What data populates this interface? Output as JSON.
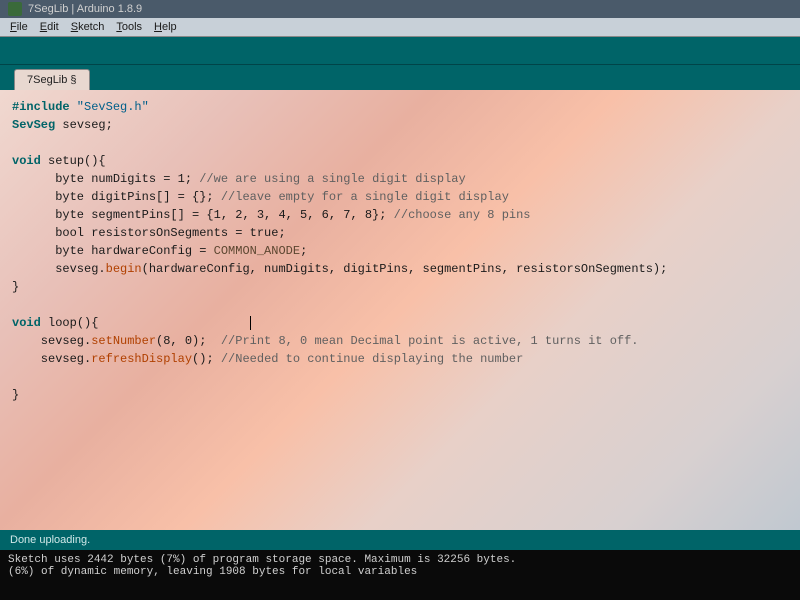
{
  "window": {
    "title": "7SegLib | Arduino 1.8.9"
  },
  "menu": {
    "file": "File",
    "edit": "Edit",
    "sketch": "Sketch",
    "tools": "Tools",
    "help": "Help"
  },
  "tab": {
    "label": "7SegLib §"
  },
  "code": {
    "l1_kw": "#include",
    "l1_str": " \"SevSeg.h\"",
    "l2_type": "SevSeg",
    "l2_rest": " sevseg;",
    "l4_kw": "void",
    "l4_rest": " setup(){",
    "l5a": "      byte numDigits = 1; ",
    "l5b": "//we are using a single digit display",
    "l6a": "      byte digitPins[] = {}; ",
    "l6b": "//leave empty for a single digit display",
    "l7a": "      byte segmentPins[] = {1, 2, 3, 4, 5, 6, 7, 8}; ",
    "l7b": "//choose any 8 pins",
    "l8": "      bool resistorsOnSegments = true;",
    "l9a": "      byte hardwareConfig = ",
    "l9b": "COMMON_ANODE",
    "l9c": ";",
    "l10a": "      sevseg.",
    "l10b": "begin",
    "l10c": "(hardwareConfig, numDigits, digitPins, segmentPins, resistorsOnSegments);",
    "l11": "}",
    "l13_kw": "void",
    "l13_rest": " loop(){",
    "l14a": "    sevseg.",
    "l14b": "setNumber",
    "l14c": "(8, 0);  ",
    "l14d": "//Print 8, 0 mean Decimal point is active, 1 turns it off.",
    "l15a": "    sevseg.",
    "l15b": "refreshDisplay",
    "l15c": "(); ",
    "l15d": "//Needed to continue displaying the number",
    "l17": "}"
  },
  "status": {
    "text": "Done uploading."
  },
  "console": {
    "line1": "Sketch uses 2442 bytes (7%) of program storage space. Maximum is 32256 bytes.",
    "line2": "                (6%) of dynamic memory, leaving 1908 bytes for local variables"
  }
}
